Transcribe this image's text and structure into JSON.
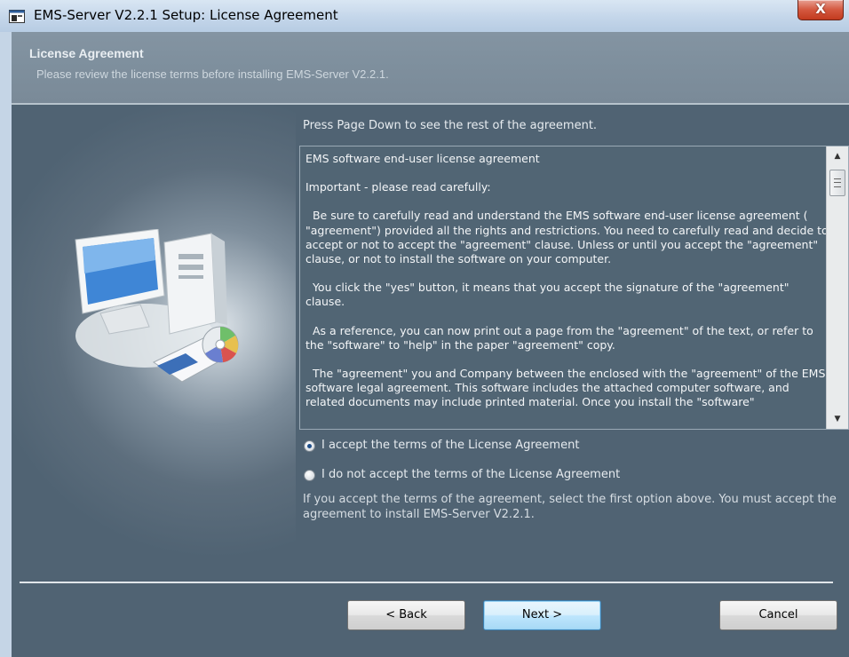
{
  "window": {
    "title": "EMS-Server V2.2.1 Setup: License Agreement",
    "close_label": "X"
  },
  "header": {
    "title": "License Agreement",
    "subtitle": "Please review the license terms before installing EMS-Server V2.2.1."
  },
  "main": {
    "instruction": "Press Page Down to see the rest of the agreement.",
    "license_paragraphs": [
      "EMS software end-user license agreement",
      "Important - please read carefully:",
      "  Be sure to carefully read and understand the EMS software end-user license agreement ( \"agreement\") provided all the rights and restrictions. You need to carefully read and decide to accept or not to accept the \"agreement\" clause. Unless or until you accept the \"agreement\" clause, or not to install the software on your computer.",
      "  You click the \"yes\" button, it means that you accept the signature of the \"agreement\" clause.",
      "  As a reference, you can now print out a page from the \"agreement\" of the text, or refer to the \"software\" to \"help\" in the paper \"agreement\" copy.",
      "  The \"agreement\" you and Company between the enclosed with the \"agreement\" of the EMS software legal agreement. This software includes the attached computer software, and related documents may include printed material. Once you install the \"software\""
    ],
    "radio_accept": "I accept the terms of the License Agreement",
    "radio_decline": "I do not accept the terms of the License Agreement",
    "accept_info": "If you accept the terms of the agreement, select the first option above. You must accept the agreement to install EMS-Server V2.2.1.",
    "selected_option": "accept"
  },
  "buttons": {
    "back": "< Back",
    "next": "Next >",
    "cancel": "Cancel"
  },
  "icons": {
    "window_icon": "installer-icon",
    "illustration": "computer-cd-illustration",
    "scroll_up": "scroll-up-arrow-icon",
    "scroll_down": "scroll-down-arrow-icon"
  },
  "colors": {
    "background": "#506373",
    "header": "#7f909e",
    "text": "#e6ebef",
    "close_button": "#c23b1f",
    "default_button_border": "#3c7fb1"
  }
}
